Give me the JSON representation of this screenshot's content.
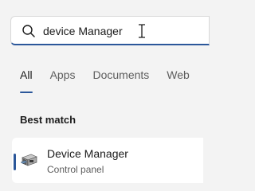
{
  "search": {
    "value": "device Manager"
  },
  "tabs": [
    {
      "label": "All",
      "active": true
    },
    {
      "label": "Apps",
      "active": false
    },
    {
      "label": "Documents",
      "active": false
    },
    {
      "label": "Web",
      "active": false
    }
  ],
  "best_match": {
    "heading": "Best match",
    "result": {
      "title": "Device Manager",
      "subtitle": "Control panel",
      "icon": "device-manager-icon"
    }
  },
  "colors": {
    "accent": "#2b579a",
    "background": "#f3f3f3",
    "card": "#ffffff"
  }
}
